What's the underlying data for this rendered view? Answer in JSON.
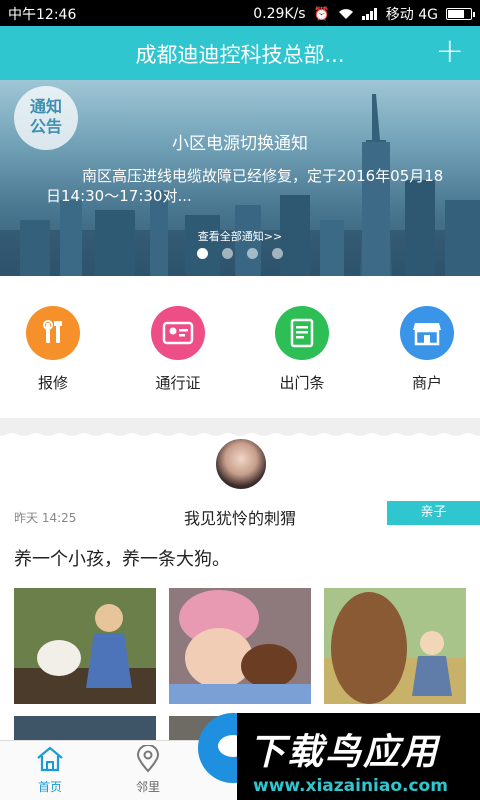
{
  "status_bar": {
    "time": "中午12:46",
    "speed": "0.29K/s",
    "carrier": "移动 4G",
    "battery_level": 0.75
  },
  "header": {
    "title": "成都迪迪控科技总部...",
    "plus": "+"
  },
  "banner": {
    "badge_line1": "通知",
    "badge_line2": "公告",
    "title": "小区电源切换通知",
    "body": "南区高压进线电缆故障已经修复，定于2016年05月18日14:30～17:30对...",
    "more": "查看全部通知>>"
  },
  "quick_actions": [
    {
      "label": "报修",
      "color": "#f5902a",
      "icon": "repair-tools-icon"
    },
    {
      "label": "通行证",
      "color": "#ee4e86",
      "icon": "id-card-icon"
    },
    {
      "label": "出门条",
      "color": "#2dbf55",
      "icon": "receipt-icon"
    },
    {
      "label": "商户",
      "color": "#3a95e8",
      "icon": "shop-icon"
    }
  ],
  "post": {
    "time": "昨天 14:25",
    "title": "我见犹怜的刺猬",
    "tag": "亲子",
    "text": "养一个小孩，养一条大狗。"
  },
  "bottom_nav": {
    "home": "首页",
    "neighbors": "邻里"
  },
  "watermark": {
    "brand": "下载鸟应用",
    "url": "www.xiazainiao.com"
  },
  "colors": {
    "accent": "#2fc6cf",
    "nav_active": "#1a9ad9"
  }
}
